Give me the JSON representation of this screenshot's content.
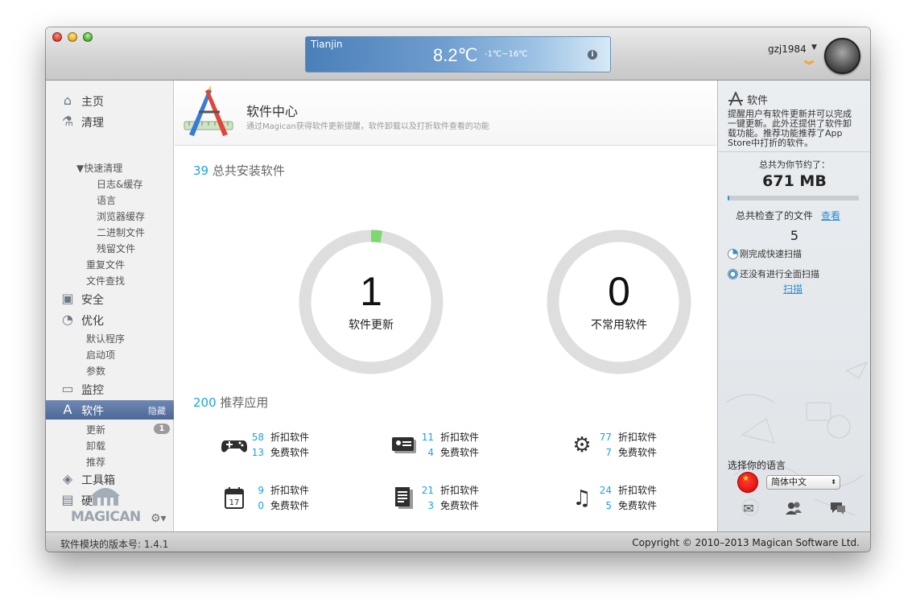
{
  "titlebar": {
    "weather": {
      "city": "Tianjin",
      "temperature": "8.2℃",
      "range": "-1℃~16℃"
    },
    "user": {
      "name": "gzj1984"
    }
  },
  "sidebar": {
    "items": [
      {
        "label": "主页",
        "icon": "home-icon"
      },
      {
        "label": "清理",
        "icon": "broom-icon"
      },
      {
        "label": "安全",
        "icon": "lock-icon"
      },
      {
        "label": "优化",
        "icon": "speed-icon"
      },
      {
        "label": "监控",
        "icon": "monitor-icon"
      },
      {
        "label": "软件",
        "icon": "app-store-icon",
        "active": true,
        "hide_label": "隐藏"
      },
      {
        "label": "工具箱",
        "icon": "toolbox-icon"
      },
      {
        "label": "硬件",
        "icon": "hardware-icon"
      }
    ],
    "clean_sub": {
      "quick": "▼快速清理",
      "quick_children": [
        "日志&缓存",
        "语言",
        "浏览器缓存",
        "二进制文件",
        "残留文件"
      ],
      "others": [
        "重复文件",
        "文件查找"
      ]
    },
    "optimize_sub": [
      "默认程序",
      "启动项",
      "参数"
    ],
    "software_sub": [
      "更新",
      "卸载",
      "推荐"
    ],
    "update_badge": "1",
    "logo": "MAGICAN"
  },
  "main": {
    "title": "软件中心",
    "description": "通过Magican获得软件更新提醒，软件卸载以及打折软件查看的功能",
    "installed": {
      "count": "39",
      "label": "总共安装软件"
    },
    "rings": [
      {
        "value": "1",
        "label": "软件更新",
        "progress": 0.025
      },
      {
        "value": "0",
        "label": "不常用软件",
        "progress": 0
      }
    ],
    "recommended": {
      "count": "200",
      "label": "推荐应用"
    },
    "discount_label": "折扣软件",
    "free_label": "免费软件",
    "categories": [
      {
        "icon": "gamepad-icon",
        "discount": "58",
        "free": "13"
      },
      {
        "icon": "id-card-icon",
        "discount": "11",
        "free": "4"
      },
      {
        "icon": "gear-icon",
        "discount": "77",
        "free": "7"
      },
      {
        "icon": "calendar-icon",
        "calendar_day": "17",
        "discount": "9",
        "free": "0"
      },
      {
        "icon": "document-icon",
        "discount": "21",
        "free": "3"
      },
      {
        "icon": "music-icon",
        "discount": "24",
        "free": "5"
      }
    ]
  },
  "right_panel": {
    "title": "软件",
    "description": "提醒用户有软件更新并可以完成一键更新。此外还提供了软件卸载功能。推荐功能推荐了App Store中打折的软件。",
    "saved_label": "总共为你节约了：",
    "saved_value": "671 MB",
    "saved_progress": 0.01,
    "checked_label": "总共检查了的文件",
    "view_link": "查看",
    "checked_count": "5",
    "quick_scan_status": "刚完成快速扫描",
    "full_scan_status": "还没有进行全面扫描",
    "scan_link": "扫描",
    "language_label": "选择你的语言",
    "language_value": "简体中文"
  },
  "statusbar": {
    "version": "软件模块的版本号: 1.4.1",
    "copyright": "Copyright © 2010–2013 Magican Software Ltd."
  }
}
